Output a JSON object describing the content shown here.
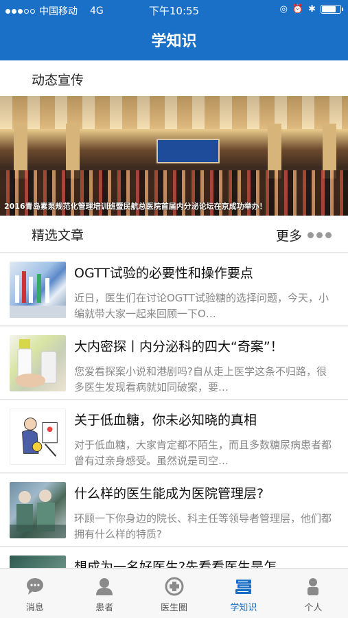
{
  "status_bar": {
    "carrier": "中国移动",
    "network": "4G",
    "time": "下午10:55"
  },
  "header": {
    "title": "学知识"
  },
  "news_section": {
    "label": "动态宣传",
    "banner_caption": "2016青岛素泵规范化管理培训班暨民航总医院首届内分泌论坛在京成功举办！"
  },
  "articles_section": {
    "label": "精选文章",
    "more_label": "更多",
    "items": [
      {
        "title": "OGTT试验的必要性和操作要点",
        "summary": "近日，医生们在讨论OGTT试验糖的选择问题，今天，小编就带大家一起来回顾一下O…"
      },
      {
        "title": "大内密探丨内分泌科的四大“奇案”！",
        "summary": "您爱看探案小说和港剧吗?自从走上医学这条不归路，很多医生发现看病就如同破案，要…"
      },
      {
        "title": "关于低血糖，你未必知晓的真相",
        "summary": "对于低血糖，大家肯定都不陌生，而且多数糖尿病患者都曾有过亲身感受。虽然说是司空…"
      },
      {
        "title": "什么样的医生能成为医院管理层?",
        "summary": "环顾一下你身边的院长、科主任等领导者管理层，他们都拥有什么样的特质?"
      },
      {
        "title": "想成为一名好医生?先看看医生是怎",
        "summary": ""
      }
    ]
  },
  "tabbar": {
    "accent_color": "#1a6fc6",
    "tabs": [
      {
        "label": "消息",
        "icon": "chat-bubble-icon",
        "active": false
      },
      {
        "label": "患者",
        "icon": "person-bust-icon",
        "active": false
      },
      {
        "label": "医生圈",
        "icon": "doctor-circle-icon",
        "active": false
      },
      {
        "label": "学知识",
        "icon": "books-icon",
        "active": true
      },
      {
        "label": "个人",
        "icon": "profile-icon",
        "active": false
      }
    ]
  }
}
